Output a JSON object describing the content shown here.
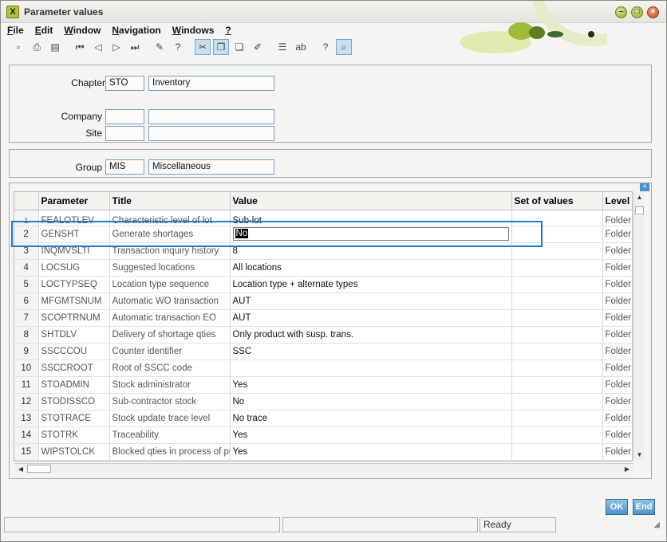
{
  "window": {
    "title": "Parameter values"
  },
  "menu": [
    {
      "label": "File",
      "mnemonic": "F",
      "rest": "ile"
    },
    {
      "label": "Edit",
      "mnemonic": "E",
      "rest": "dit"
    },
    {
      "label": "Window",
      "mnemonic": "W",
      "rest": "indow"
    },
    {
      "label": "Navigation",
      "mnemonic": "N",
      "rest": "avigation"
    },
    {
      "label": "Windows",
      "mnemonic": "W",
      "rest": "indows"
    },
    {
      "label": "?",
      "mnemonic": "?",
      "rest": ""
    }
  ],
  "header": {
    "chapter_label": "Chapter",
    "chapter_code": "STO",
    "chapter_name": "Inventory",
    "company_label": "Company",
    "company_code": "",
    "company_name": "",
    "site_label": "Site",
    "site_code": "",
    "site_name": ""
  },
  "group": {
    "label": "Group",
    "code": "MIS",
    "name": "Miscellaneous"
  },
  "grid": {
    "columns": [
      "",
      "Parameter",
      "Title",
      "Value",
      "Set of values",
      "Level"
    ],
    "rows": [
      {
        "n": "1",
        "param": "FEALOTLEV",
        "title": "Characteristic level of lot",
        "value": "Sub-lot",
        "set": "",
        "level": "Folder"
      },
      {
        "n": "2",
        "param": "GENSHT",
        "title": "Generate shortages",
        "value": "No",
        "set": "",
        "level": "Folder"
      },
      {
        "n": "3",
        "param": "INQMVSLTI",
        "title": "Transaction inquiry history",
        "value": "8",
        "set": "",
        "level": "Folder"
      },
      {
        "n": "4",
        "param": "LOCSUG",
        "title": "Suggested locations",
        "value": "All locations",
        "set": "",
        "level": "Folder"
      },
      {
        "n": "5",
        "param": "LOCTYPSEQ",
        "title": "Location type sequence",
        "value": "Location type + alternate types",
        "set": "",
        "level": "Folder"
      },
      {
        "n": "6",
        "param": "MFGMTSNUM",
        "title": "Automatic WO transaction",
        "value": "AUT",
        "set": "",
        "level": "Folder"
      },
      {
        "n": "7",
        "param": "SCOPTRNUM",
        "title": "Automatic transaction EO",
        "value": "AUT",
        "set": "",
        "level": "Folder"
      },
      {
        "n": "8",
        "param": "SHTDLV",
        "title": "Delivery of shortage qties",
        "value": "Only product with susp. trans.",
        "set": "",
        "level": "Folder"
      },
      {
        "n": "9",
        "param": "SSCCCOU",
        "title": "Counter identifier",
        "value": "SSC",
        "set": "",
        "level": "Folder"
      },
      {
        "n": "10",
        "param": "SSCCROOT",
        "title": "Root of SSCC code",
        "value": "",
        "set": "",
        "level": "Folder"
      },
      {
        "n": "11",
        "param": "STOADMIN",
        "title": "Stock administrator",
        "value": "Yes",
        "set": "",
        "level": "Folder"
      },
      {
        "n": "12",
        "param": "STODISSCO",
        "title": "Sub-contractor stock",
        "value": "No",
        "set": "",
        "level": "Folder"
      },
      {
        "n": "13",
        "param": "STOTRACE",
        "title": "Stock update trace level",
        "value": "No trace",
        "set": "",
        "level": "Folder"
      },
      {
        "n": "14",
        "param": "STOTRK",
        "title": "Traceability",
        "value": "Yes",
        "set": "",
        "level": "Folder"
      },
      {
        "n": "15",
        "param": "WIPSTOLCK",
        "title": "Blocked qties in process of pu",
        "value": "Yes",
        "set": "",
        "level": "Folder"
      }
    ]
  },
  "buttons": {
    "ok": "OK",
    "end": "End"
  },
  "status": {
    "text": "Ready"
  },
  "colors": {
    "accent": "#1e7bcc",
    "button": "#4f92c6"
  }
}
